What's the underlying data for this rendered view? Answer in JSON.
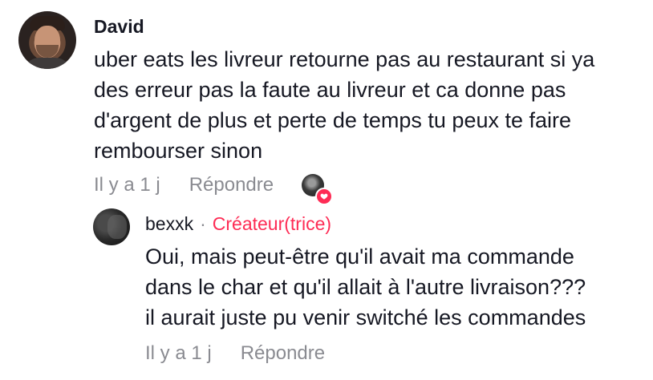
{
  "comment": {
    "author": "David",
    "text_lines": [
      "uber eats les livreur retourne pas au restaurant si ya",
      "des erreur pas la faute au livreur et ca donne pas",
      "d'argent de plus et perte de temps tu peux te faire",
      "rembourser sinon"
    ],
    "time": "Il y a 1 j",
    "reply_label": "Répondre",
    "liked_by_creator": true
  },
  "reply": {
    "author": "bexxk",
    "separator": "·",
    "badge": "Créateur(trice)",
    "text_lines": [
      "Oui, mais peut-être qu'il avait ma commande",
      "dans le char et qu'il allait à l'autre livraison???",
      "il aurait juste pu venir switché les commandes"
    ],
    "time": "Il y a 1 j",
    "reply_label": "Répondre"
  },
  "colors": {
    "text": "#161823",
    "muted": "#8a8b91",
    "accent": "#fe2c55"
  },
  "icons": {
    "liked": "heart-icon"
  }
}
